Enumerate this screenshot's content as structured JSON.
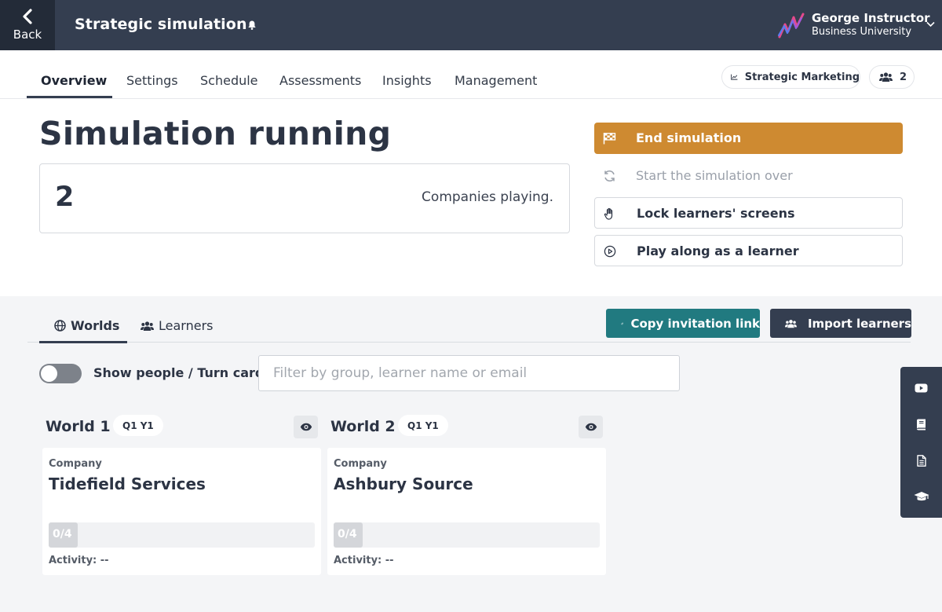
{
  "header": {
    "back_label": "Back",
    "title": "Strategic simulation",
    "user_name": "George Instructor",
    "user_org": "Business University"
  },
  "tabs": [
    {
      "label": "Overview",
      "active": true
    },
    {
      "label": "Settings"
    },
    {
      "label": "Schedule"
    },
    {
      "label": "Assessments"
    },
    {
      "label": "Insights"
    },
    {
      "label": "Management"
    }
  ],
  "course": {
    "label": "Strategic Marketing",
    "learner_count": "2"
  },
  "status": {
    "headline": "Simulation running",
    "companies_count": "2",
    "companies_label": "Companies playing."
  },
  "actions": {
    "end": "End simulation",
    "restart": "Start the simulation over",
    "lock": "Lock learners' screens",
    "play": "Play along as a learner"
  },
  "lower": {
    "tab_worlds": "Worlds",
    "tab_learners": "Learners",
    "copy_link": "Copy invitation link",
    "import": "Import learners",
    "toggle_label": "Show people / Turn cards",
    "toggle_on": false,
    "filter_placeholder": "Filter by group, learner name or email",
    "filter_value": ""
  },
  "worlds": [
    {
      "title": "World 1",
      "period": "Q1 Y1",
      "company_kicker": "Company",
      "company_name": "Tidefield Services",
      "progress_text": "0/4",
      "progress_fraction": 0,
      "activity": "Activity: --"
    },
    {
      "title": "World 2",
      "period": "Q1 Y1",
      "company_kicker": "Company",
      "company_name": "Ashbury Source",
      "progress_text": "0/4",
      "progress_fraction": 0,
      "activity": "Activity: --"
    }
  ],
  "dock_icons": [
    "video-icon",
    "book-icon",
    "document-icon",
    "graduation-cap-icon"
  ],
  "colors": {
    "topbar": "#343e50",
    "back": "#232b38",
    "primary_action": "#ce8a31",
    "teal_button": "#217a80",
    "dark_button": "#343e50",
    "panel_bg": "#f4f5f7"
  }
}
